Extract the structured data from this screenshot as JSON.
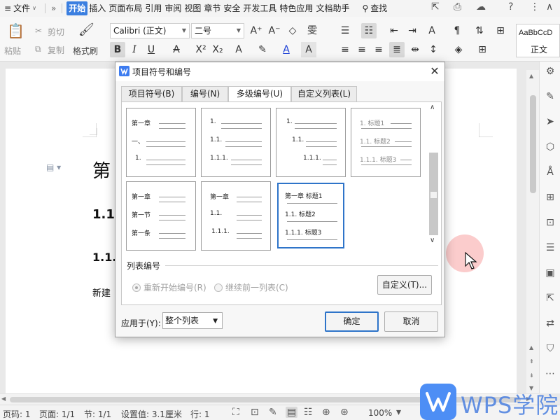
{
  "menu": {
    "file": "文件",
    "tabs": [
      "开始",
      "插入",
      "页面布局",
      "引用",
      "审阅",
      "视图",
      "章节",
      "安全",
      "开发工具",
      "特色应用",
      "文档助手"
    ],
    "search": "查找"
  },
  "ribbon": {
    "paste": "粘贴",
    "cut": "剪切",
    "copy": "复制",
    "format_painter": "格式刷",
    "font_name": "Calibri (正文)",
    "font_size": "二号",
    "style_preview": "AaBbCcD",
    "style_name": "正文"
  },
  "document": {
    "heading1": "第",
    "heading2": "1.1.",
    "heading3": "1.1.",
    "body": "新建"
  },
  "dialog": {
    "title": "项目符号和编号",
    "tabs": [
      "项目符号(B)",
      "编号(N)",
      "多级编号(U)",
      "自定义列表(L)"
    ],
    "active_tab": "多级编号(U)",
    "gallery": [
      {
        "lines": [
          "第一章",
          "一、",
          "1."
        ]
      },
      {
        "lines": [
          "1.",
          "1.1.",
          "1.1.1."
        ]
      },
      {
        "lines": [
          "1.",
          "1.1.",
          "1.1.1."
        ]
      },
      {
        "lines": [
          "1. 标题1",
          "1.1. 标题2",
          "1.1.1. 标题3"
        ]
      },
      {
        "lines": [
          "第一章",
          "第一节",
          "第一条"
        ]
      },
      {
        "lines": [
          "第一章",
          "1.1.",
          "1.1.1."
        ]
      },
      {
        "lines": [
          "第一章 标题1",
          "1.1. 标题2",
          "1.1.1. 标题3"
        ]
      }
    ],
    "selected_index": 6,
    "list_numbering_label": "列表编号",
    "restart_label": "重新开始编号(R)",
    "continue_label": "继续前一列表(C)",
    "custom_button": "自定义(T)...",
    "apply_label": "应用于(Y):",
    "apply_value": "整个列表",
    "ok_button": "确定",
    "cancel_button": "取消"
  },
  "status": {
    "page_num": "页码: 1",
    "pages": "页面: 1/1",
    "section": "节: 1/1",
    "setting": "设置值: 3.1厘米",
    "row": "行: 1",
    "zoom": "100%"
  },
  "watermark": {
    "text": "WPS学院"
  },
  "colors": {
    "accent": "#3b7fe0",
    "selected_border": "#2e74c9",
    "click_indicator": "#f47878"
  }
}
